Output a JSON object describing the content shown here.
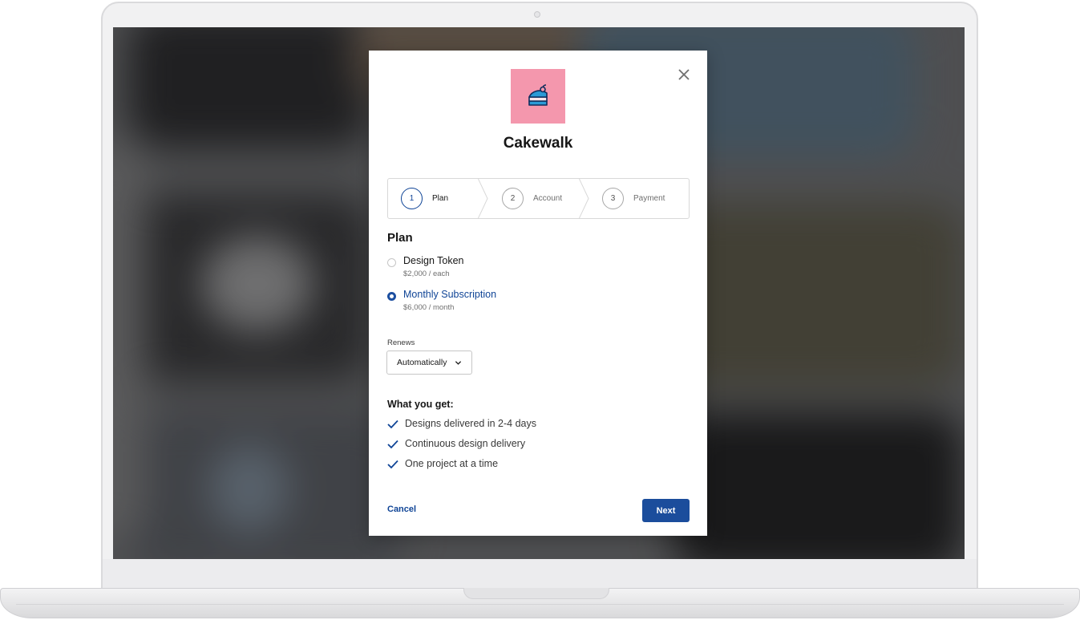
{
  "app": {
    "name": "Cakewalk",
    "logo_icon": "cake-slice-icon",
    "logo_bg": "#f497ad"
  },
  "stepper": {
    "steps": [
      {
        "number": "1",
        "label": "Plan",
        "active": true
      },
      {
        "number": "2",
        "label": "Account",
        "active": false
      },
      {
        "number": "3",
        "label": "Payment",
        "active": false
      }
    ]
  },
  "plan": {
    "title": "Plan",
    "options": [
      {
        "label": "Design Token",
        "price": "$2,000 / each",
        "selected": false
      },
      {
        "label": "Monthly Subscription",
        "price": "$6,000 / month",
        "selected": true
      }
    ]
  },
  "renews": {
    "label": "Renews",
    "value": "Automatically"
  },
  "benefits": {
    "title": "What you get:",
    "items": [
      "Designs delivered in 2-4 days",
      "Continuous design delivery",
      "One project at a time"
    ]
  },
  "actions": {
    "cancel_label": "Cancel",
    "next_label": "Next"
  },
  "colors": {
    "accent": "#0f4496",
    "primary_button": "#1b4d9c"
  }
}
